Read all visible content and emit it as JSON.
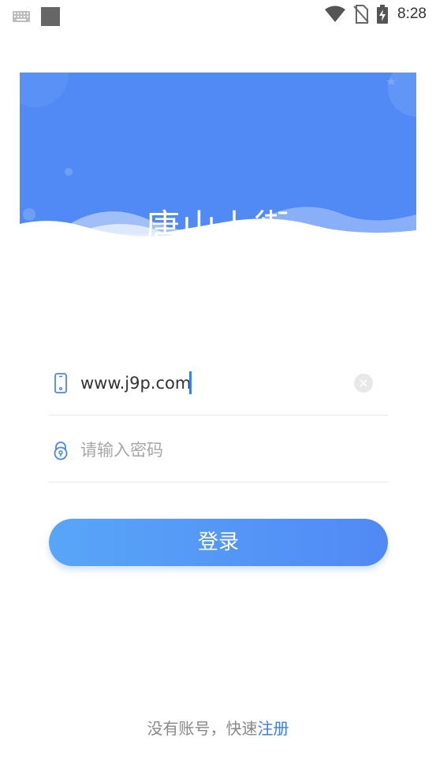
{
  "status_bar": {
    "time": "8:28",
    "icons": [
      "keyboard-icon",
      "notification-square-icon",
      "wifi-icon",
      "no-sim-icon",
      "battery-charging-icon"
    ]
  },
  "banner": {
    "title": "唐山上街"
  },
  "login_form": {
    "username": {
      "value": "www.j9p.com",
      "icon": "phone-icon"
    },
    "password": {
      "placeholder": "请输入密码",
      "icon": "lock-icon"
    },
    "login_button_label": "登录"
  },
  "footer": {
    "prompt": "没有账号，快速",
    "register_link": "注册"
  },
  "colors": {
    "banner_blue": "#5189f5",
    "button_start": "#58a6f8",
    "button_end": "#5189f5",
    "link": "#3b7cf0"
  }
}
